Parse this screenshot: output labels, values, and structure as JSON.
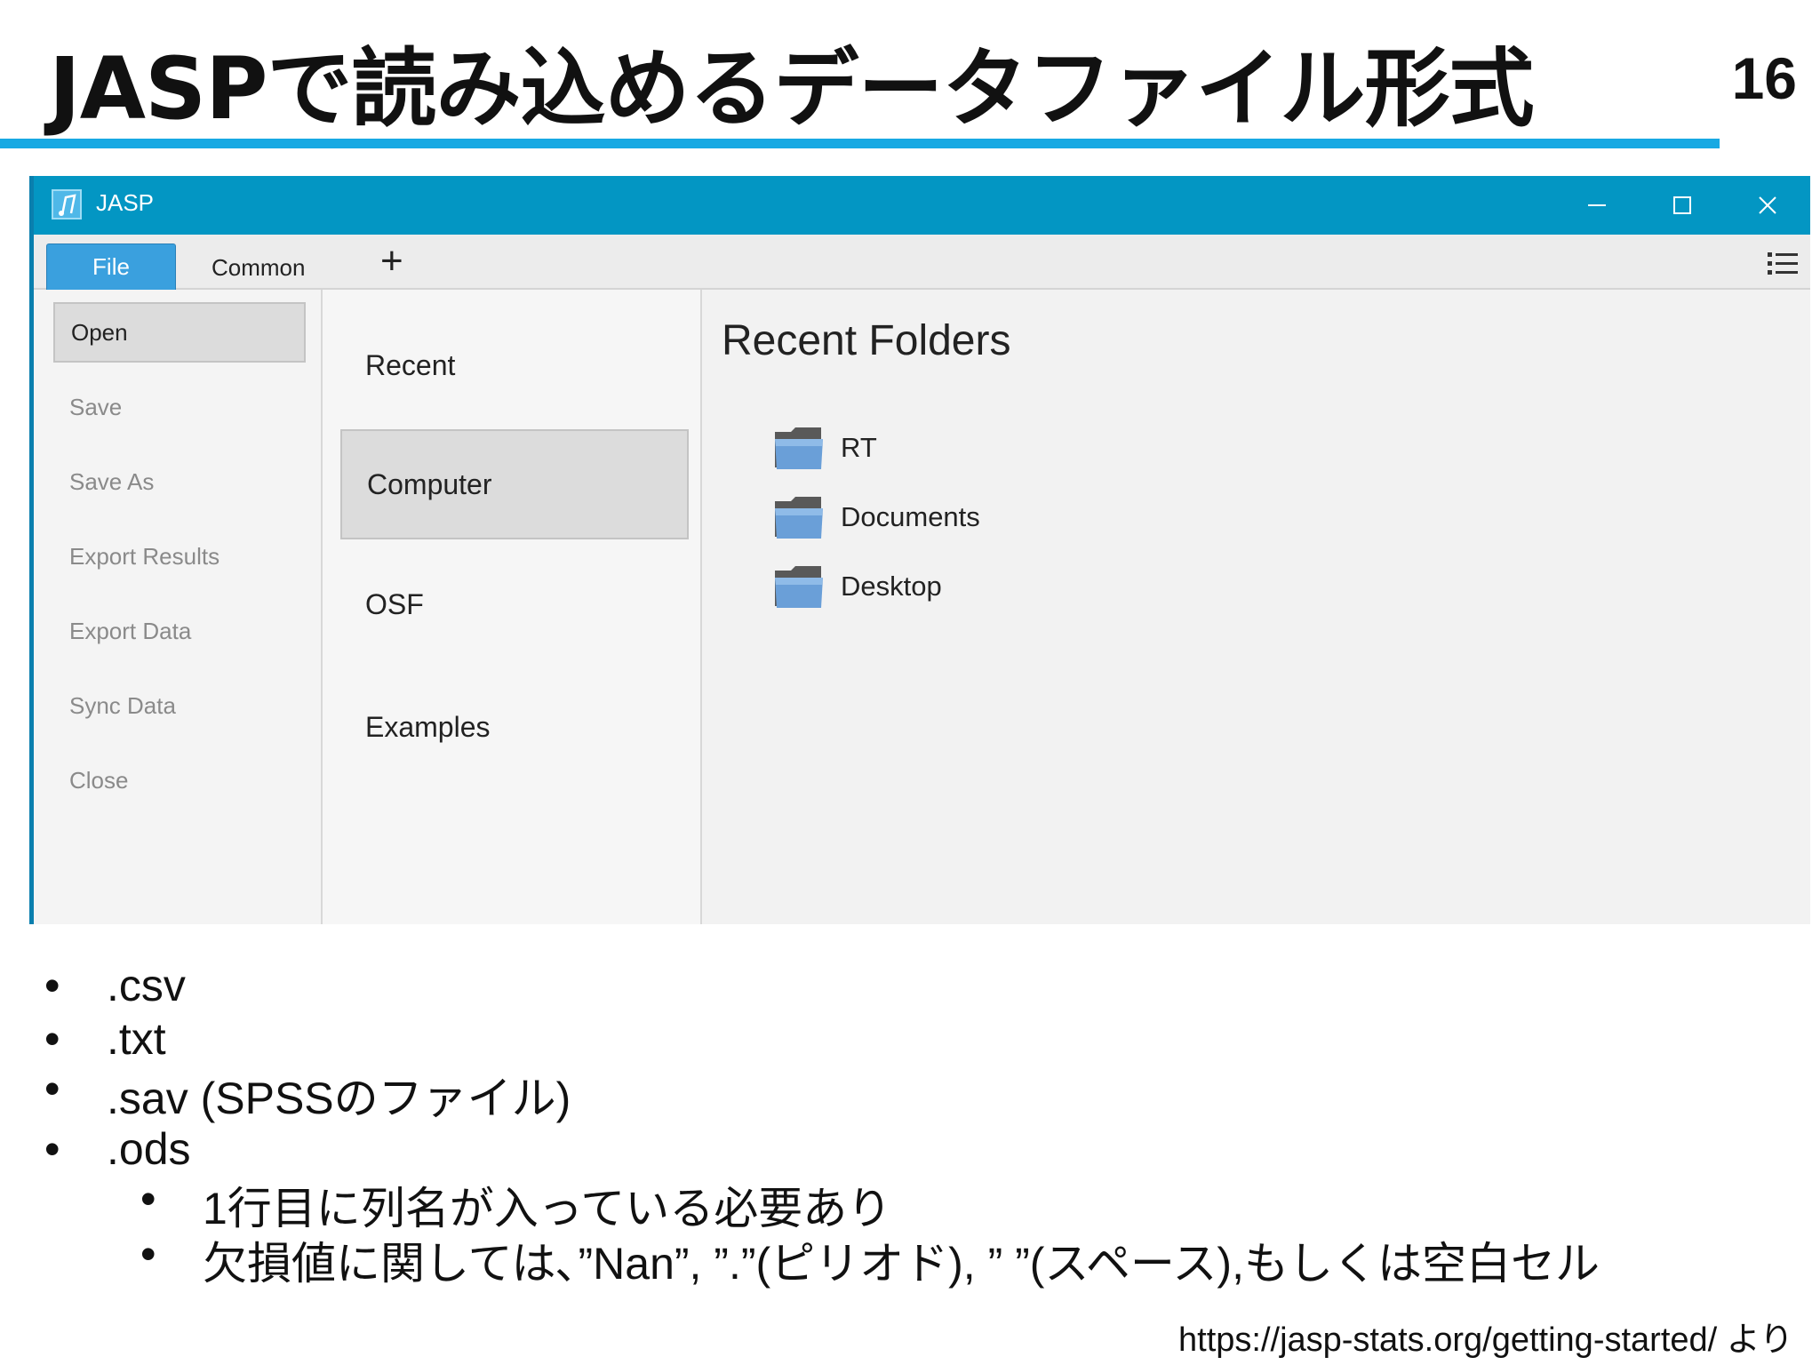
{
  "slide": {
    "title": "JASPで読み込めるデータファイル形式",
    "page_number": "16",
    "source_note": "https://jasp-stats.org/getting-started/ より"
  },
  "window": {
    "app_title": "JASP",
    "controls": [
      "minimize-icon",
      "maximize-icon",
      "close-icon"
    ],
    "tabs": {
      "file": "File",
      "common": "Common",
      "add": "+"
    },
    "left_menu": [
      "Open",
      "Save",
      "Save As",
      "Export Results",
      "Export Data",
      "Sync Data",
      "Close"
    ],
    "left_menu_selected": "Open",
    "locations": [
      "Recent",
      "Computer",
      "OSF",
      "Examples"
    ],
    "locations_selected": "Computer",
    "recent_heading": "Recent Folders",
    "folders": [
      "RT",
      "Documents",
      "Desktop"
    ]
  },
  "formats": {
    "items": [
      ".csv",
      ".txt",
      ".sav (SPSSのファイル)",
      ".ods"
    ],
    "ods_notes": [
      "1行目に列名が入っている必要あり",
      "欠損値に関しては､”Nan”, ”.”(ピリオド), ” ”(スペース),もしくは空白セル"
    ]
  },
  "colors": {
    "accent_rule": "#17a9e3",
    "titlebar": "#0396c3",
    "file_tab": "#3aa0de",
    "folder": "#6a9fd8"
  }
}
